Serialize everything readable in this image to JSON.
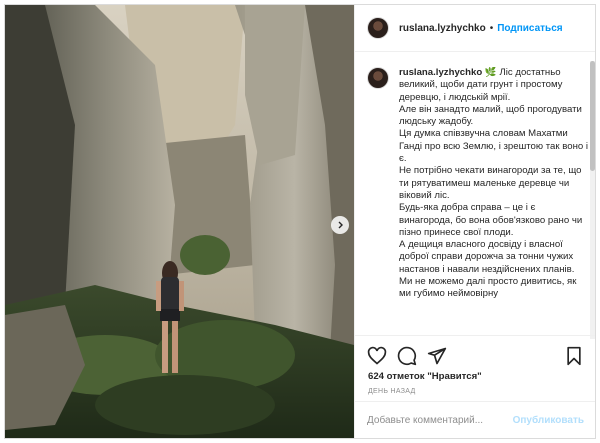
{
  "post": {
    "username": "ruslana.lyzhychko",
    "follow_label": "Подписаться",
    "caption_lines": [
      "Ліс достатньо великий, щоби дати грунт і простому деревцю, і людській мрії.",
      "Але він занадто малий, щоб прогодувати людську жадобу.",
      "Ця думка співзвучна словам Махатми Ганді про всю Землю, і зрештою так воно і є.",
      "Не потрібно чекати винагороди за те, що ти рятуватимеш маленьке деревце чи віковий ліс.",
      "Будь-яка добра справа – це і є винагорода, бо вона обов'язково рано чи пізно принесе свої плоди.",
      "А дещиця власного досвіду і власної доброї справи дорожча за тонни чужих настанов і навали нездійснених планів.",
      "Ми не можемо далі просто дивитись, як ми губимо неймовірну"
    ],
    "likes_text": "624 отметок \"Нравится\"",
    "timestamp": "ДЕНЬ НАЗАД",
    "comment_placeholder": "Добавьте комментарий...",
    "publish_label": "Опубликовать"
  },
  "icons": {
    "like": "heart-icon",
    "comment": "comment-icon",
    "share": "share-icon",
    "save": "bookmark-icon",
    "next": "chevron-right-icon",
    "caption_emoji": "leaf-emoji-icon"
  },
  "colors": {
    "link_blue": "#0095f6",
    "publish_disabled": "#b2dffc",
    "muted": "#8e8e8e"
  }
}
